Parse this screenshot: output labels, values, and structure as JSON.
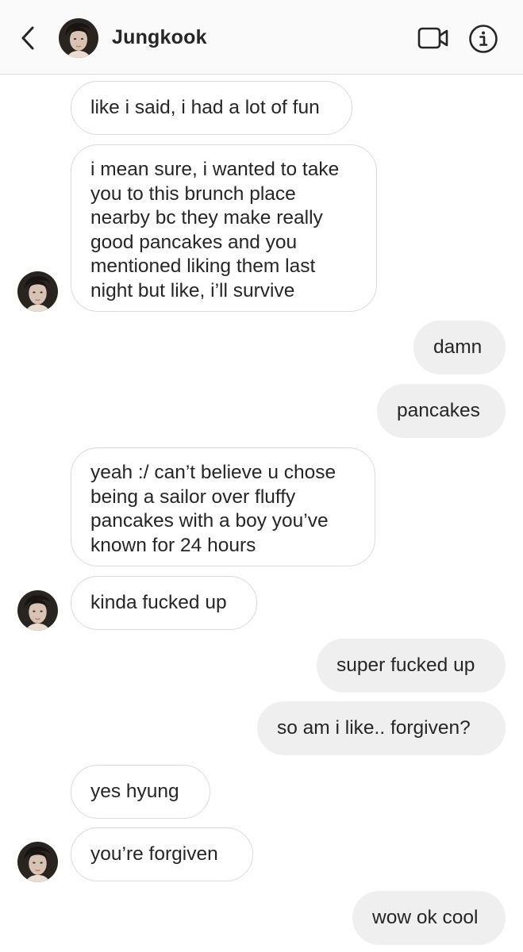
{
  "header": {
    "contact_name": "Jungkook",
    "icons": {
      "back": "chevron-left-icon",
      "video": "video-camera-icon",
      "info": "info-icon"
    }
  },
  "messages": [
    {
      "sender": "them",
      "text": "like i said, i had a lot of fun"
    },
    {
      "sender": "them",
      "lines": [
        "i mean sure, i wanted to take",
        "you to this brunch place",
        "nearby bc they make really",
        "good pancakes and you",
        "mentioned liking them last",
        "night but like, i’ll survive"
      ]
    },
    {
      "sender": "me",
      "text": "damn"
    },
    {
      "sender": "me",
      "text": "pancakes"
    },
    {
      "sender": "them",
      "lines": [
        "yeah :/ can’t believe u chose",
        "being a sailor over fluffy",
        "pancakes with a boy you’ve",
        "known for 24 hours"
      ]
    },
    {
      "sender": "them",
      "text": "kinda fucked up"
    },
    {
      "sender": "me",
      "text": "super fucked up"
    },
    {
      "sender": "me",
      "text": "so am i like.. forgiven?"
    },
    {
      "sender": "them",
      "text": "yes hyung"
    },
    {
      "sender": "them",
      "text": "you’re forgiven"
    },
    {
      "sender": "me",
      "text": "wow ok cool"
    }
  ],
  "colors": {
    "outgoing_bubble": "#efefef",
    "incoming_border": "#dbdbdb",
    "text": "#262626",
    "header_bg": "#fafafa"
  }
}
